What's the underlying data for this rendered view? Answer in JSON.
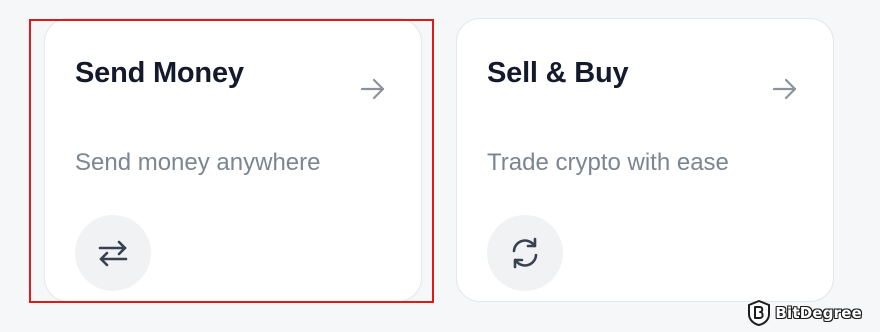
{
  "cards": [
    {
      "title": "Send Money",
      "description": "Send money anywhere",
      "arrow_icon": "arrow-right-icon",
      "action_icon": "swap-arrows-icon"
    },
    {
      "title": "Sell & Buy",
      "description": "Trade crypto with ease",
      "arrow_icon": "arrow-right-icon",
      "action_icon": "refresh-icon"
    }
  ],
  "highlight": {
    "target": "Send Money",
    "color": "#e01a1a"
  },
  "watermark": {
    "text": "BitDegree"
  },
  "colors": {
    "background": "#f6f7f9",
    "card": "#ffffff",
    "title": "#141a2b",
    "description": "#7c8591",
    "icon": "#374151"
  }
}
